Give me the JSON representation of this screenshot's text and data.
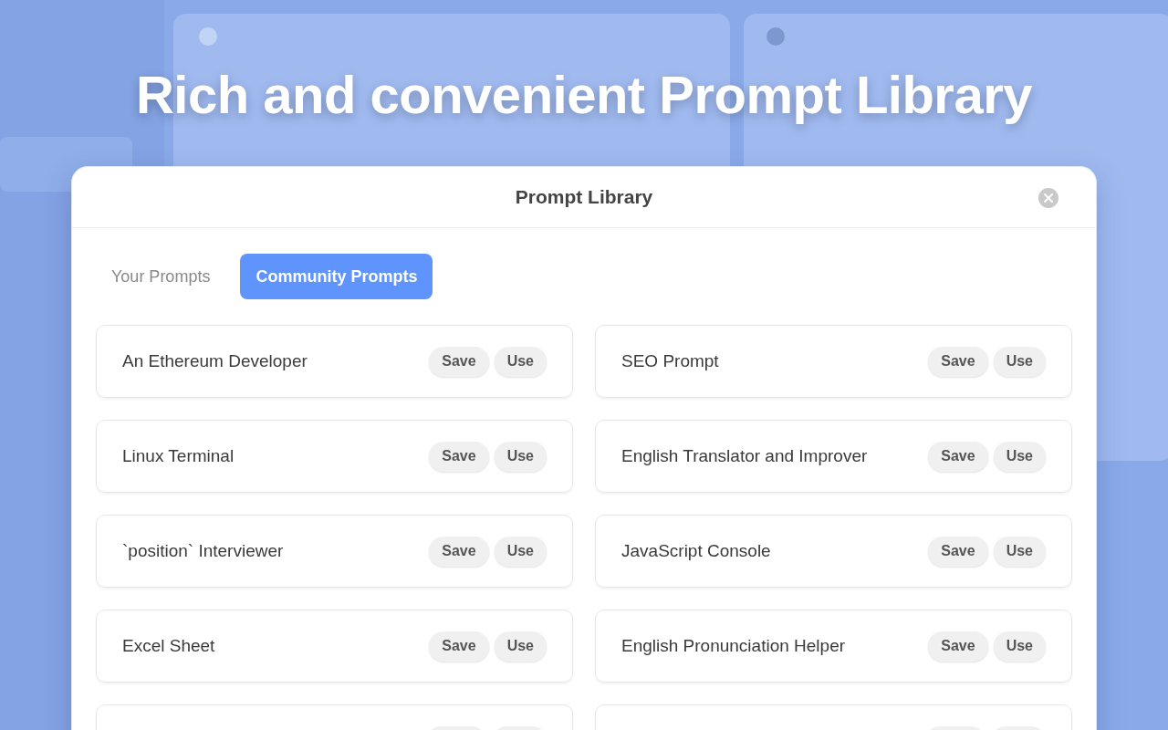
{
  "headline": "Rich and convenient Prompt Library",
  "dialog": {
    "title": "Prompt Library"
  },
  "tabs": [
    {
      "label": "Your Prompts",
      "selected": false
    },
    {
      "label": "Community Prompts",
      "selected": true
    }
  ],
  "prompts": [
    {
      "title": "An Ethereum Developer",
      "actions": [
        "Save",
        "Use"
      ]
    },
    {
      "title": "SEO Prompt",
      "actions": [
        "Save",
        "Use"
      ]
    },
    {
      "title": "Linux Terminal",
      "actions": [
        "Save",
        "Use"
      ]
    },
    {
      "title": "English Translator and Improver",
      "actions": [
        "Save",
        "Use"
      ]
    },
    {
      "title": "`position` Interviewer",
      "actions": [
        "Save",
        "Use"
      ]
    },
    {
      "title": "JavaScript Console",
      "actions": [
        "Save",
        "Use"
      ]
    },
    {
      "title": "Excel Sheet",
      "actions": [
        "Save",
        "Use"
      ]
    },
    {
      "title": "English Pronunciation Helper",
      "actions": [
        "Save",
        "Use"
      ]
    },
    {
      "kind": "cut"
    },
    {
      "kind": "cut"
    }
  ]
}
